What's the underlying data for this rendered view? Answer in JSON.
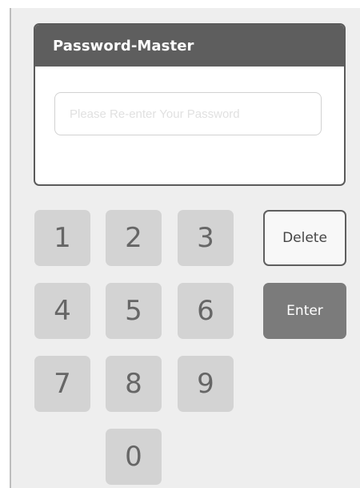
{
  "dialog": {
    "title": "Password-Master",
    "password_field": {
      "value": "",
      "placeholder": "Please Re-enter Your Password"
    }
  },
  "keypad": {
    "keys": [
      "1",
      "2",
      "3",
      "4",
      "5",
      "6",
      "7",
      "8",
      "9",
      "0"
    ]
  },
  "actions": {
    "delete_label": "Delete",
    "enter_label": "Enter"
  },
  "colors": {
    "header_bg": "#5e5e5e",
    "key_bg": "#d3d3d3",
    "enter_bg": "#7b7b7b",
    "background": "#eeeeee"
  }
}
